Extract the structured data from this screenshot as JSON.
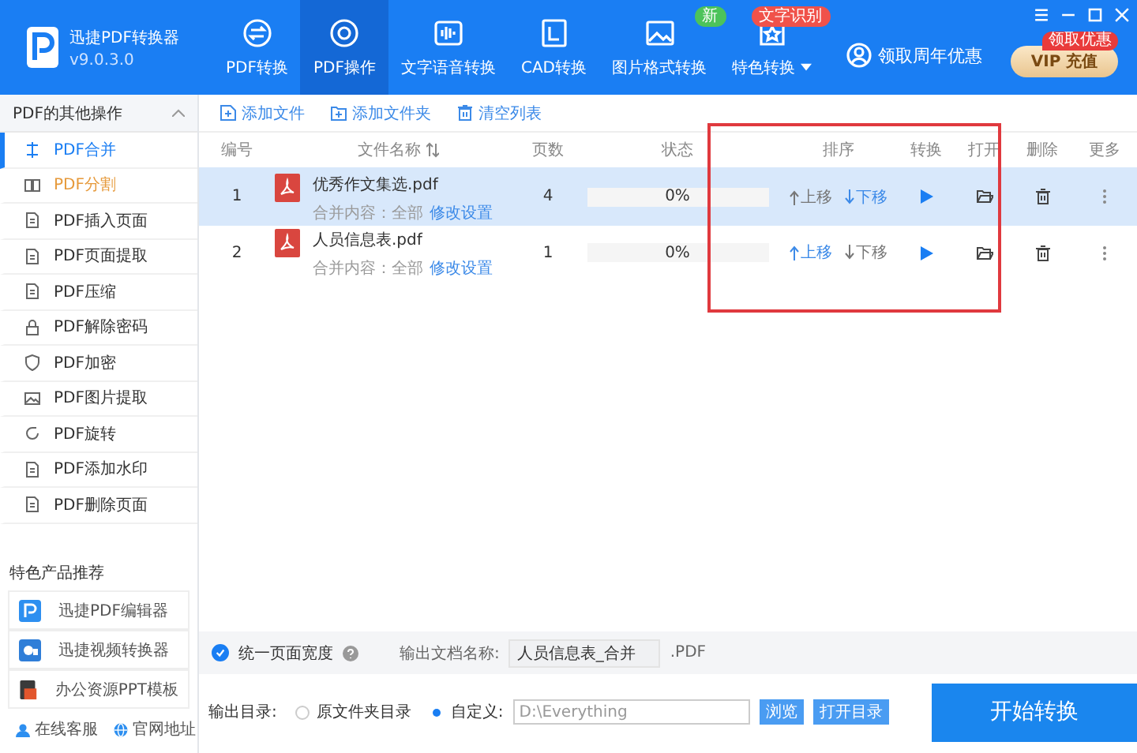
{
  "app": {
    "name": "迅捷PDF转换器",
    "version": "v9.0.3.0"
  },
  "nav_tabs": [
    {
      "label": "PDF转换",
      "selected": false
    },
    {
      "label": "PDF操作",
      "selected": true
    },
    {
      "label": "文字语音转换",
      "selected": false
    },
    {
      "label": "CAD转换",
      "selected": false
    },
    {
      "label": "图片格式转换",
      "selected": false,
      "badge": {
        "text": "新",
        "kind": "new"
      }
    },
    {
      "label": "特色转换",
      "selected": false,
      "badge": {
        "text": "文字识别",
        "kind": "feature"
      },
      "dropdown": true
    }
  ],
  "promo_link": "领取周年优惠",
  "vip_button": {
    "label": "VIP 充值",
    "badge": "领取优惠"
  },
  "sidebar": {
    "title": "PDF的其他操作",
    "items": [
      {
        "label": "PDF合并",
        "selected": true,
        "hovered": false
      },
      {
        "label": "PDF分割",
        "selected": false,
        "hovered": true
      },
      {
        "label": "PDF插入页面",
        "selected": false,
        "hovered": false
      },
      {
        "label": "PDF页面提取",
        "selected": false,
        "hovered": false
      },
      {
        "label": "PDF压缩",
        "selected": false,
        "hovered": false
      },
      {
        "label": "PDF解除密码",
        "selected": false,
        "hovered": false
      },
      {
        "label": "PDF加密",
        "selected": false,
        "hovered": false
      },
      {
        "label": "PDF图片提取",
        "selected": false,
        "hovered": false
      },
      {
        "label": "PDF旋转",
        "selected": false,
        "hovered": false
      },
      {
        "label": "PDF添加水印",
        "selected": false,
        "hovered": false
      },
      {
        "label": "PDF删除页面",
        "selected": false,
        "hovered": false
      }
    ],
    "products_title": "特色产品推荐",
    "products": [
      "迅捷PDF编辑器",
      "迅捷视频转换器",
      "办公资源PPT模板"
    ],
    "footer_links": [
      "在线客服",
      "官网地址"
    ]
  },
  "toolbar": [
    "添加文件",
    "添加文件夹",
    "清空列表"
  ],
  "table": {
    "columns": [
      "编号",
      "文件名称",
      "页数",
      "状态",
      "排序",
      "转换",
      "打开",
      "删除",
      "更多"
    ],
    "rows": [
      {
        "index": "1",
        "file": "优秀作文集选.pdf",
        "pages": "4",
        "level": 0,
        "progress": "0%",
        "merge_label": "合并内容：全部",
        "settings_link": "修改设置",
        "up": "上移",
        "down": "下移",
        "up_enabled": false,
        "down_enabled": true,
        "selected": true
      },
      {
        "index": "2",
        "file": "人员信息表.pdf",
        "pages": "1",
        "level": 0,
        "progress": "0%",
        "merge_label": "合并内容：全部",
        "settings_link": "修改设置",
        "up": "上移",
        "down": "下移",
        "up_enabled": true,
        "down_enabled": false,
        "selected": false
      }
    ]
  },
  "options": {
    "uniform_width": {
      "label": "统一页面宽度",
      "checked": true
    },
    "name_label": "输出文档名称:",
    "name_value": "人员信息表_合并",
    "extension": ".PDF"
  },
  "output": {
    "label": "输出目录:",
    "choices": [
      {
        "label": "原文件夹目录",
        "selected": false
      },
      {
        "label": "自定义:",
        "selected": true
      }
    ],
    "path": "D:\\Everything",
    "browse": "浏览",
    "open": "打开目录",
    "start": "开始转换"
  }
}
